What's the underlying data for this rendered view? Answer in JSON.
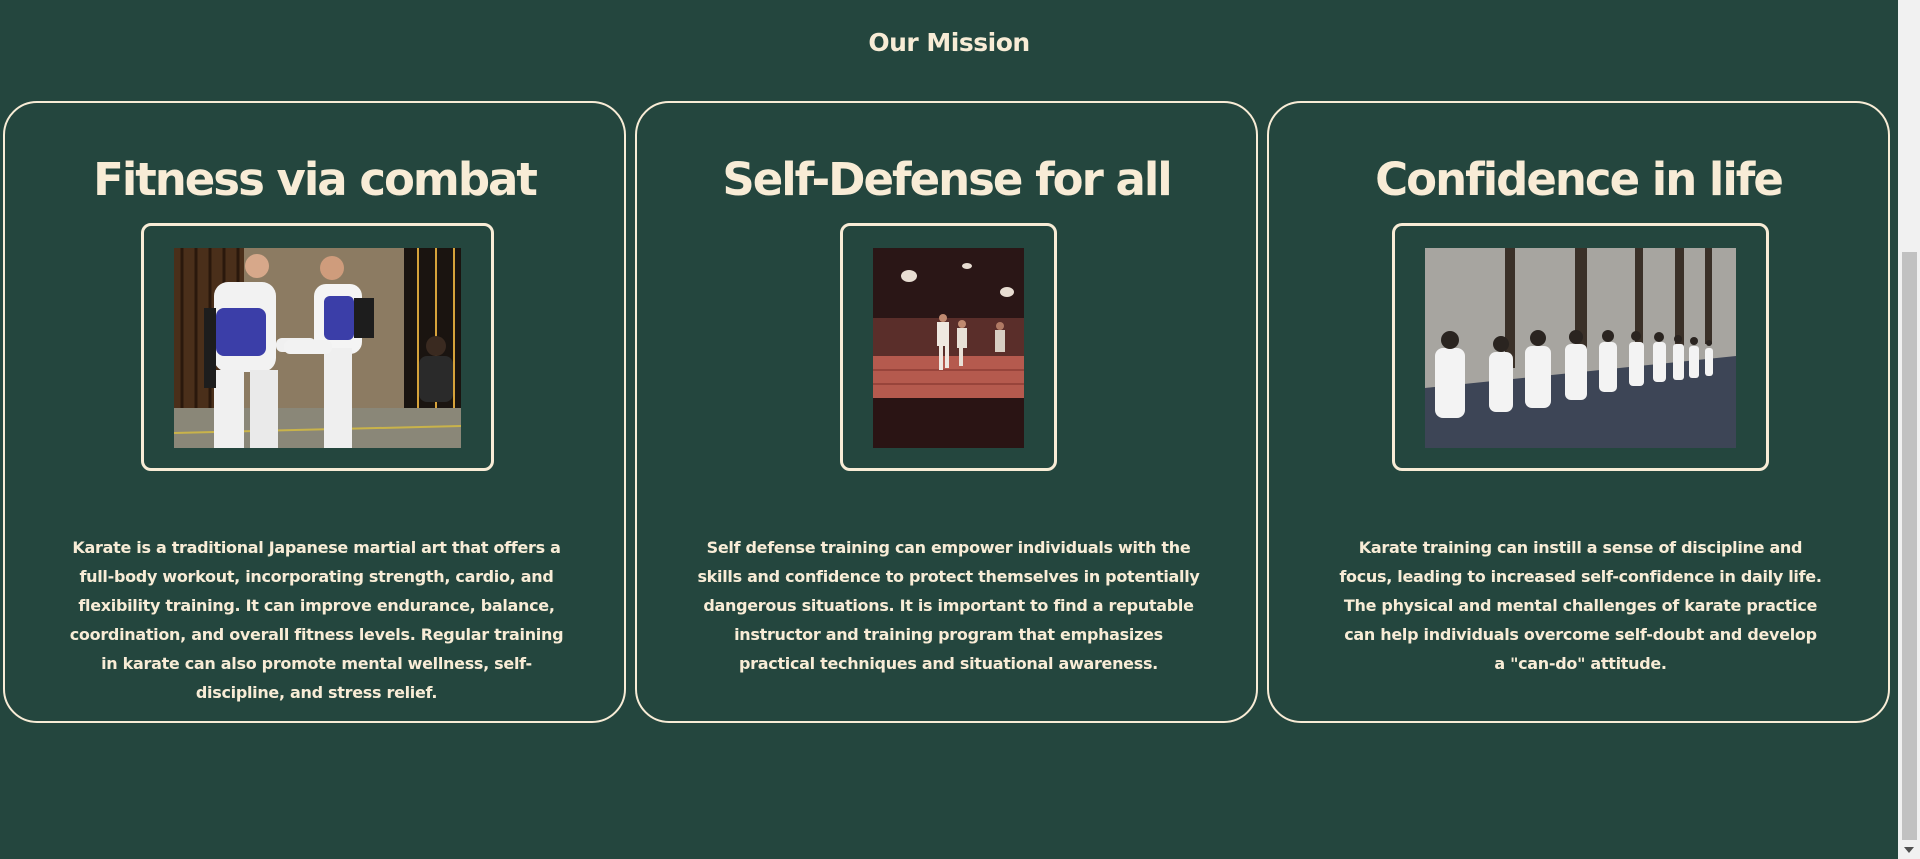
{
  "section": {
    "title": "Our Mission"
  },
  "cards": [
    {
      "title": "Fitness via combat",
      "image_subject": "two karate practitioners sparring in a gym",
      "text": "Karate is a traditional Japanese martial art that offers a full-body workout, incorporating strength, cardio, and flexibility training. It can improve endurance, balance, coordination, and overall fitness levels. Regular training in karate can also promote mental wellness, self-discipline, and stress relief."
    },
    {
      "title": "Self-Defense for all",
      "image_subject": "students practicing in a red-lit dojo",
      "text": "Self defense training can empower individuals with the skills and confidence to protect themselves in potentially dangerous situations. It is important to find a reputable instructor and training program that emphasizes practical techniques and situational awareness."
    },
    {
      "title": "Confidence in life",
      "image_subject": "row of karate students kneeling outdoors",
      "text": "Karate training can instill a sense of discipline and focus, leading to increased self-confidence in daily life. The physical and mental challenges of karate practice can help individuals overcome self-doubt and develop a \"can-do\" attitude."
    }
  ],
  "colors": {
    "background": "#24463e",
    "accent": "#f8ecd6"
  }
}
